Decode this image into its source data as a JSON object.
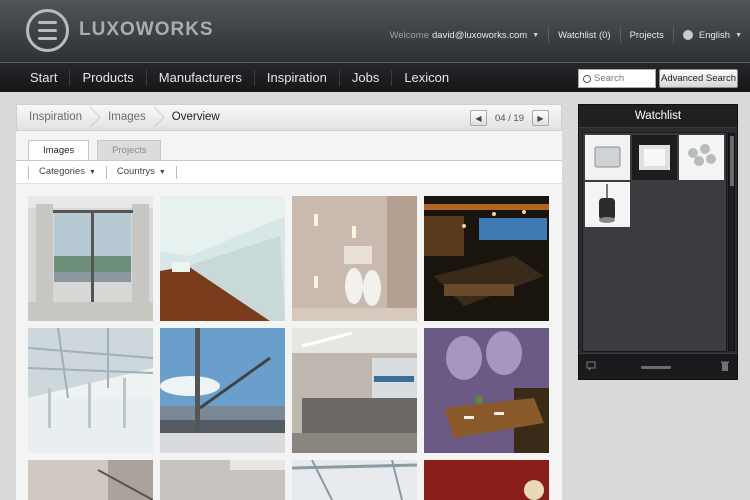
{
  "brand": {
    "name": "LUXOWORKS"
  },
  "header": {
    "welcome_label": "Welcome",
    "user_email": "david@luxoworks.com",
    "watchlist_link": "Watchlist (0)",
    "projects_link": "Projects",
    "language": "English"
  },
  "nav": {
    "items": [
      "Start",
      "Products",
      "Manufacturers",
      "Inspiration",
      "Jobs",
      "Lexicon"
    ],
    "search_placeholder": "Search",
    "advanced_search": "Advanced Search"
  },
  "breadcrumb": {
    "items": [
      "Inspiration",
      "Images",
      "Overview"
    ],
    "page_indicator": "04 / 19"
  },
  "tabs": [
    "Images",
    "Projects"
  ],
  "filters": [
    "Categories",
    "Countrys"
  ],
  "images": [
    "window-ocean-view",
    "white-corridor",
    "white-chairs-wall-lights",
    "dark-lounge-bar",
    "open-office-ceiling",
    "balcony-lamp-sky",
    "reception-desk",
    "restaurant-dining",
    "partial-thumb-1",
    "partial-thumb-2",
    "partial-thumb-3",
    "partial-thumb-4"
  ],
  "watchlist": {
    "title": "Watchlist",
    "items": [
      "panel-light",
      "recessed-square-light",
      "cluster-spotlight",
      "pendant-spotlight"
    ]
  },
  "colors": {
    "header_top": "#505357",
    "navbar": "#1a1b1d",
    "accent": "#e4e6e8"
  }
}
